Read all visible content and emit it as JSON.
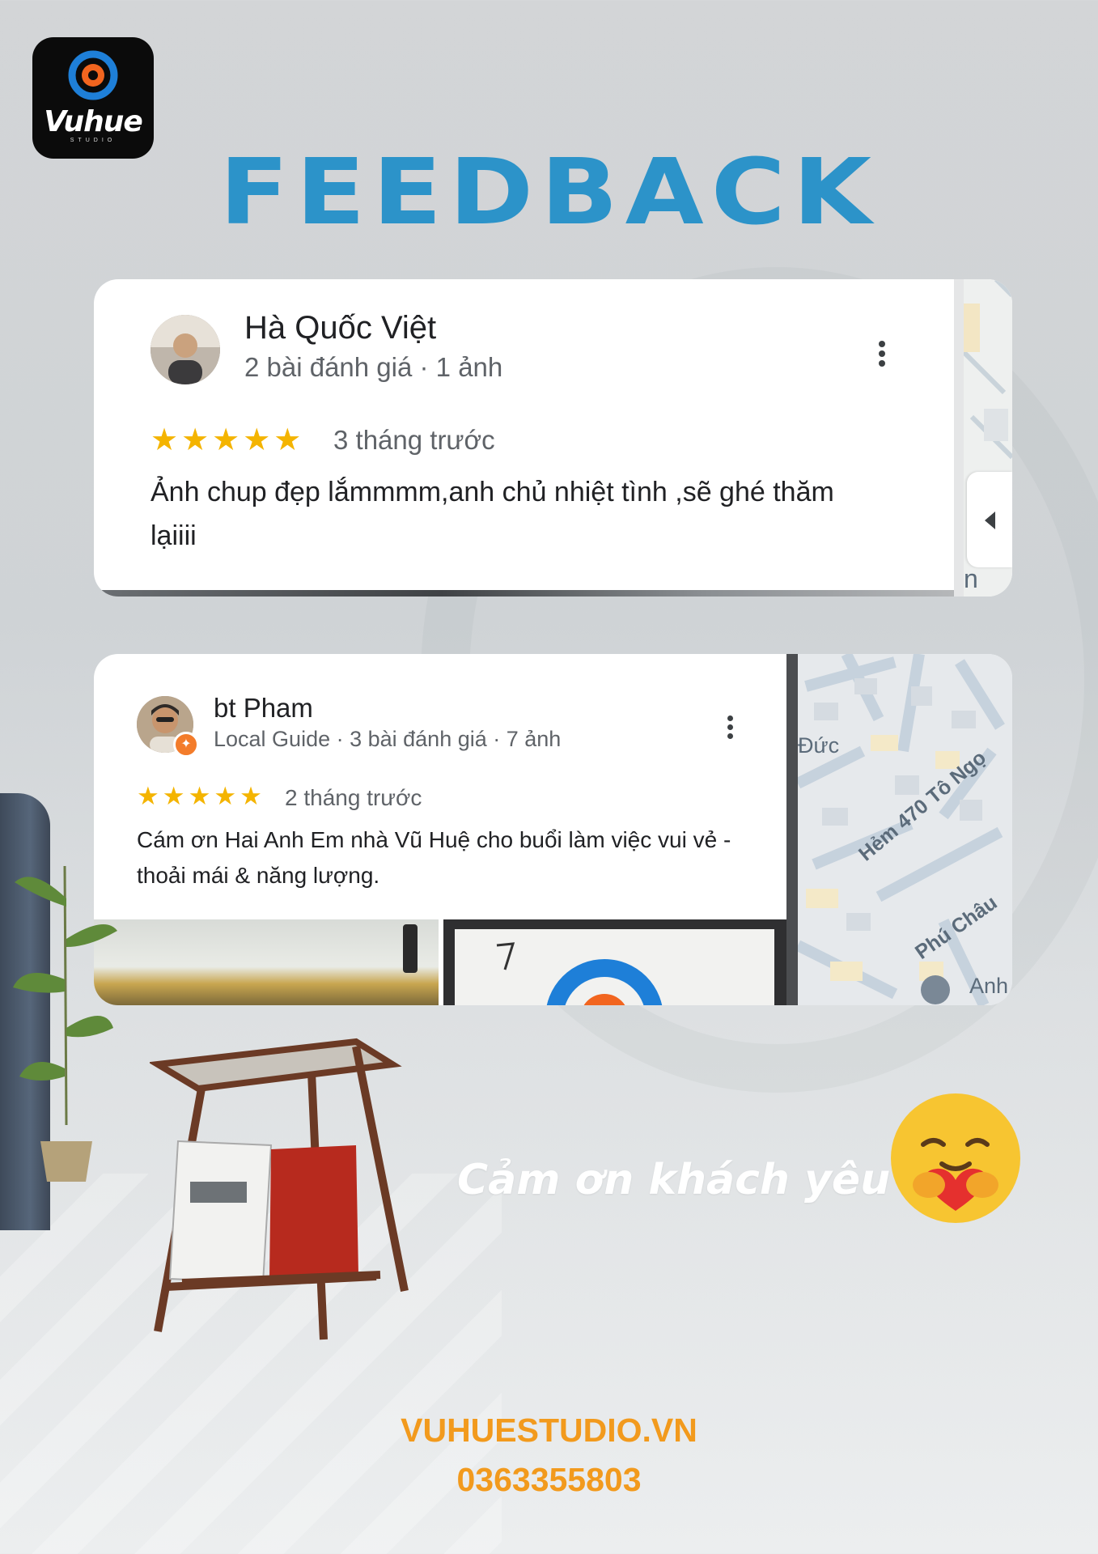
{
  "brand": {
    "logo_text": "Vuhue",
    "logo_subtext": "STUDIO",
    "colors": {
      "title": "#2c93c9",
      "accent": "#f29a1d",
      "star": "#f4b400"
    }
  },
  "title": "FEEDBACK",
  "reviews": [
    {
      "name": "Hà Quốc Việt",
      "meta": "2 bài đánh giá · 1 ảnh",
      "rating": 5,
      "stars": "★★★★★",
      "time": "3 tháng trước",
      "text": "Ảnh chup đẹp lắmmmm,anh chủ nhiệt tình ,sẽ ghé thăm lạiiii",
      "map_label": "n Ha"
    },
    {
      "name": "bt Pham",
      "meta": "Local Guide · 3 bài đánh giá · 7 ảnh",
      "rating": 5,
      "stars": "★★★★★",
      "time": "2 tháng trước",
      "text": "Cám ơn Hai Anh Em nhà Vũ Huệ cho buổi làm việc vui vẻ - thoải mái & năng lượng.",
      "map_labels": [
        "Đức",
        "Hẻm 470 Tô Ngọ",
        "Phú Châu",
        "Anh"
      ]
    }
  ],
  "thanks": "Cảm ơn khách yêu ạ",
  "icons": [
    "more-vert-icon",
    "chevron-left-icon",
    "star-icon",
    "hug-emoji-icon"
  ],
  "footer": {
    "website": "VUHUESTUDIO.VN",
    "phone": "0363355803"
  }
}
